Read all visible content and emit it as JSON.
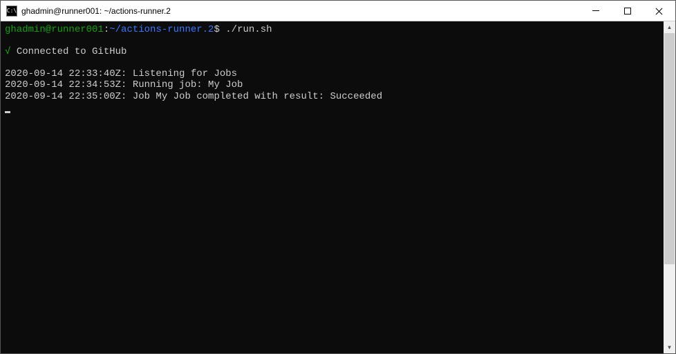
{
  "window": {
    "icon_text": "C:\\",
    "title": "ghadmin@runner001: ~/actions-runner.2"
  },
  "prompt": {
    "user_host": "ghadmin@runner001",
    "sep1": ":",
    "path": "~/actions-runner.2",
    "sep2": "$",
    "command": "./run.sh"
  },
  "status": {
    "check": "√",
    "message": "Connected to GitHub"
  },
  "log": [
    "2020-09-14 22:33:40Z: Listening for Jobs",
    "2020-09-14 22:34:53Z: Running job: My Job",
    "2020-09-14 22:35:00Z: Job My Job completed with result: Succeeded"
  ]
}
